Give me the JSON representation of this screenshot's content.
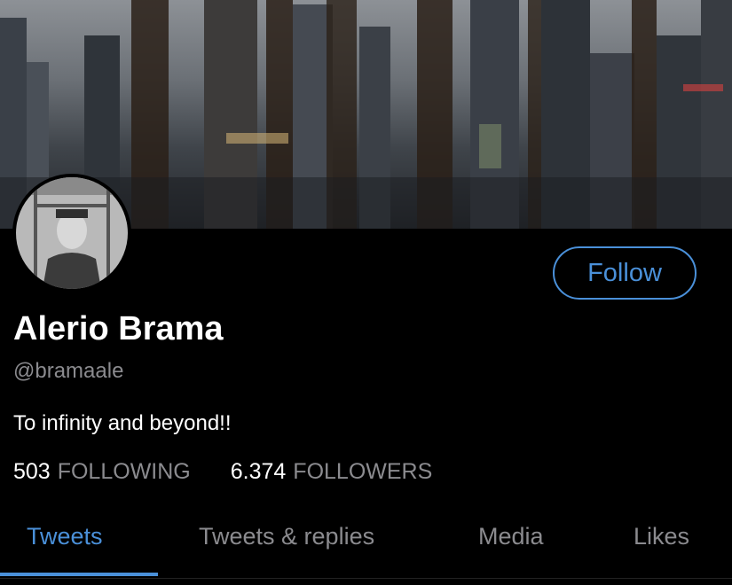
{
  "profile": {
    "name": "Alerio Brama",
    "handle": "@bramaale",
    "bio": "To infinity and beyond!!",
    "follow_label": "Follow",
    "following_count": "503",
    "following_label": "FOLLOWING",
    "followers_count": "6.374",
    "followers_label": "FOLLOWERS"
  },
  "tabs": [
    {
      "label": "Tweets",
      "active": true
    },
    {
      "label": "Tweets & replies",
      "active": false
    },
    {
      "label": "Media",
      "active": false
    },
    {
      "label": "Likes",
      "active": false
    }
  ],
  "colors": {
    "accent": "#4a90d9",
    "background": "#000000",
    "secondary_text": "#8b8b8f"
  }
}
